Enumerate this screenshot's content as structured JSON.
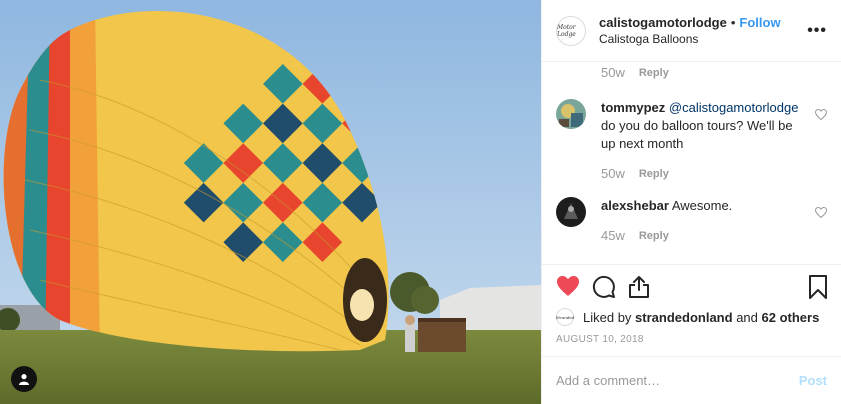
{
  "header": {
    "username": "calistogamotorlodge",
    "separator": "•",
    "follow_label": "Follow",
    "location": "Calistoga Balloons",
    "more_icon": "•••",
    "avatar_text": "Motor Lodge"
  },
  "comments": [
    {
      "time": "50w",
      "reply": "Reply"
    },
    {
      "user": "tommypez",
      "mention": "@calistogamotorlodge",
      "text": "do you do balloon tours? We'll be up next month",
      "time": "50w",
      "reply": "Reply"
    },
    {
      "user": "alexshebar",
      "text": "Awesome.",
      "time": "45w",
      "reply": "Reply"
    }
  ],
  "likes": {
    "prefix": "Liked by",
    "user": "strandedonland",
    "and": "and",
    "others": "62 others",
    "avatar_text": "Stranded"
  },
  "date": "AUGUST 10, 2018",
  "comment_box": {
    "placeholder": "Add a comment…",
    "post_label": "Post"
  },
  "colors": {
    "accent": "#3897f0",
    "like": "#ed4956",
    "post_disabled": "#b2dffc"
  }
}
